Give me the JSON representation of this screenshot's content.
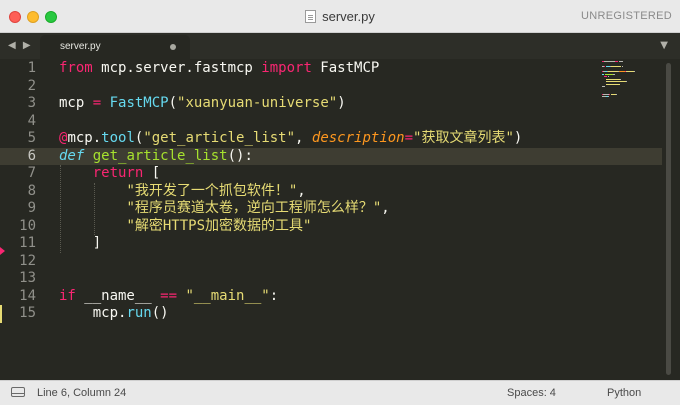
{
  "window": {
    "title": "server.py",
    "license_status": "UNREGISTERED"
  },
  "tabs": [
    {
      "label": "server.py",
      "modified": true
    }
  ],
  "editor": {
    "line_numbers": [
      "1",
      "2",
      "3",
      "4",
      "5",
      "6",
      "7",
      "8",
      "9",
      "10",
      "11",
      "12",
      "13",
      "14",
      "15"
    ],
    "active_line": 6,
    "lines": [
      [
        {
          "t": "kw",
          "v": "from"
        },
        {
          "t": "txt",
          "v": " mcp.server.fastmcp "
        },
        {
          "t": "kw",
          "v": "import"
        },
        {
          "t": "txt",
          "v": " FastMCP"
        }
      ],
      [],
      [
        {
          "t": "txt",
          "v": "mcp "
        },
        {
          "t": "kw",
          "v": "="
        },
        {
          "t": "txt",
          "v": " "
        },
        {
          "t": "fn",
          "v": "FastMCP"
        },
        {
          "t": "txt",
          "v": "("
        },
        {
          "t": "str",
          "v": "\"xuanyuan-universe\""
        },
        {
          "t": "txt",
          "v": ")"
        }
      ],
      [],
      [
        {
          "t": "kw",
          "v": "@"
        },
        {
          "t": "txt",
          "v": "mcp."
        },
        {
          "t": "fn",
          "v": "tool"
        },
        {
          "t": "txt",
          "v": "("
        },
        {
          "t": "str",
          "v": "\"get_article_list\""
        },
        {
          "t": "txt",
          "v": ", "
        },
        {
          "t": "arg",
          "v": "description"
        },
        {
          "t": "kw",
          "v": "="
        },
        {
          "t": "str",
          "v": "\"获取文章列表\""
        },
        {
          "t": "txt",
          "v": ")"
        }
      ],
      [
        {
          "t": "def",
          "v": "def"
        },
        {
          "t": "txt",
          "v": " "
        },
        {
          "t": "name",
          "v": "get_article_list"
        },
        {
          "t": "txt",
          "v": "():"
        }
      ],
      [
        {
          "t": "txt",
          "v": "    "
        },
        {
          "t": "kw",
          "v": "return"
        },
        {
          "t": "txt",
          "v": " ["
        }
      ],
      [
        {
          "t": "txt",
          "v": "        "
        },
        {
          "t": "str",
          "v": "\"我开发了一个抓包软件！\""
        },
        {
          "t": "txt",
          "v": ","
        }
      ],
      [
        {
          "t": "txt",
          "v": "        "
        },
        {
          "t": "str",
          "v": "\"程序员赛道太卷，逆向工程师怎么样？\""
        },
        {
          "t": "txt",
          "v": ","
        }
      ],
      [
        {
          "t": "txt",
          "v": "        "
        },
        {
          "t": "str",
          "v": "\"解密HTTPS加密数据的工具\""
        }
      ],
      [
        {
          "t": "txt",
          "v": "    ]"
        }
      ],
      [],
      [],
      [
        {
          "t": "kw",
          "v": "if"
        },
        {
          "t": "txt",
          "v": " __name__ "
        },
        {
          "t": "kw",
          "v": "=="
        },
        {
          "t": "txt",
          "v": " "
        },
        {
          "t": "str",
          "v": "\"__main__\""
        },
        {
          "t": "txt",
          "v": ":"
        }
      ],
      [
        {
          "t": "txt",
          "v": "    mcp."
        },
        {
          "t": "fn",
          "v": "run"
        },
        {
          "t": "txt",
          "v": "()"
        }
      ]
    ]
  },
  "statusbar": {
    "position": "Line 6, Column 24",
    "indentation": "Spaces: 4",
    "syntax": "Python"
  },
  "colors": {
    "background": "#272822",
    "keyword": "#f92672",
    "string": "#e6db74",
    "function": "#66d9ef",
    "name": "#a6e22e",
    "argument": "#fd971f",
    "text": "#f8f8f2"
  }
}
